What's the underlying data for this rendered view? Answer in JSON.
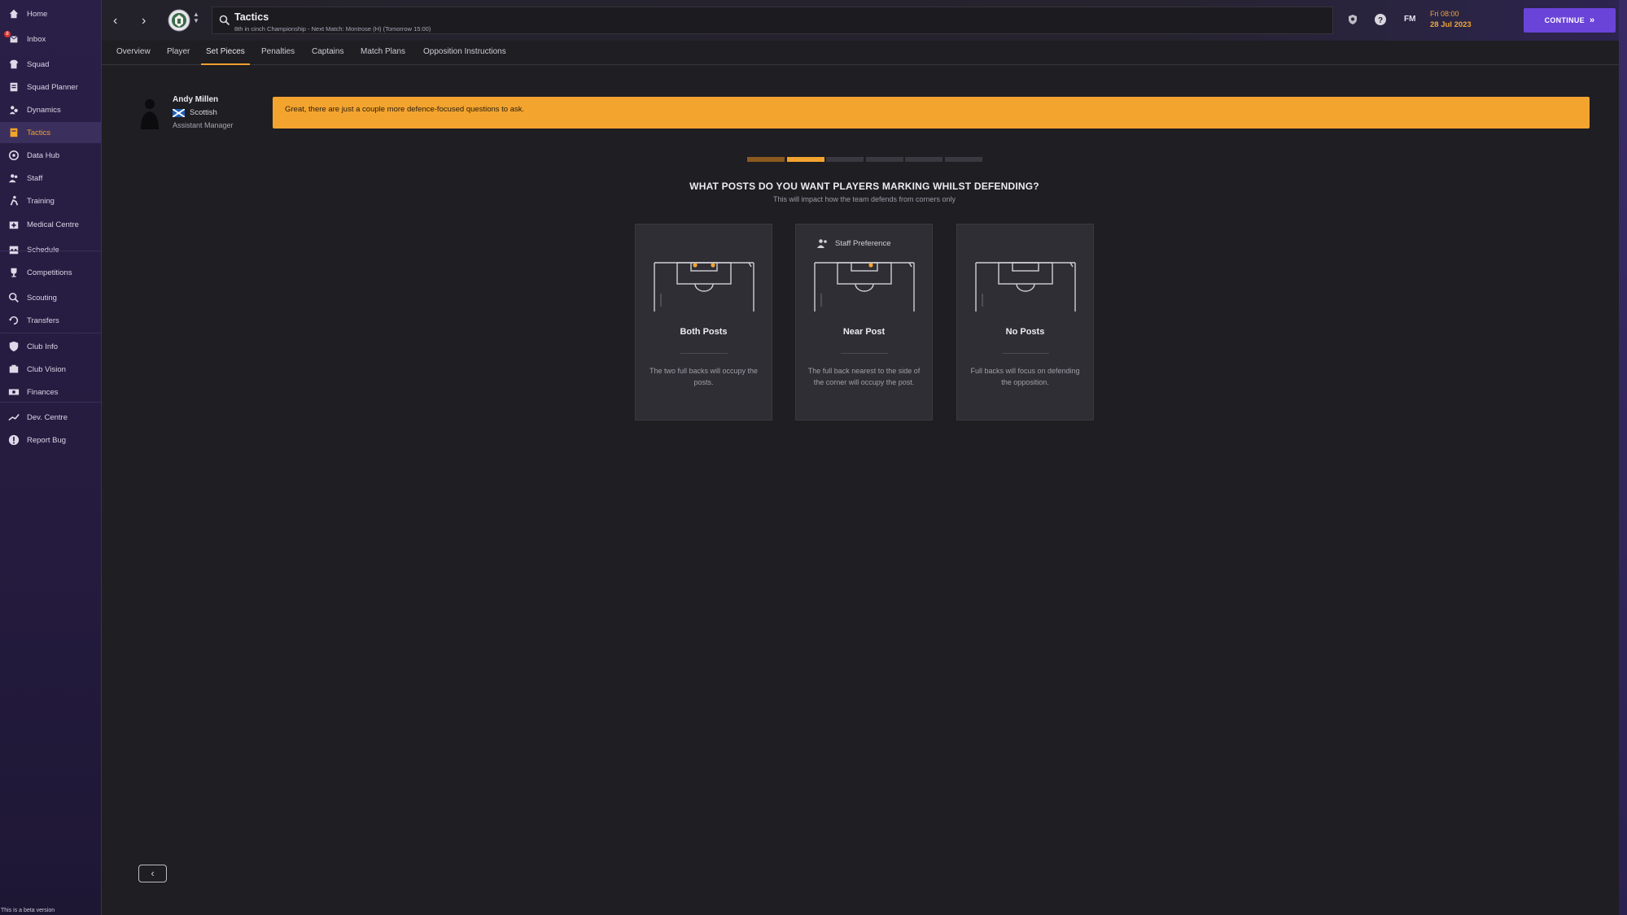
{
  "sidebar": {
    "items": [
      {
        "label": "Home",
        "icon": "home-icon"
      },
      {
        "label": "Inbox",
        "icon": "inbox-icon",
        "badge": "8"
      },
      {
        "label": "Squad",
        "icon": "shirt-icon"
      },
      {
        "label": "Squad Planner",
        "icon": "planner-icon"
      },
      {
        "label": "Dynamics",
        "icon": "dynamics-icon"
      },
      {
        "label": "Tactics",
        "icon": "tactics-icon",
        "active": true
      },
      {
        "label": "Data Hub",
        "icon": "data-hub-icon"
      },
      {
        "label": "Staff",
        "icon": "staff-icon"
      },
      {
        "label": "Training",
        "icon": "training-icon"
      },
      {
        "label": "Medical Centre",
        "icon": "medical-icon"
      },
      {
        "label": "Schedule",
        "icon": "calendar-icon"
      },
      {
        "label": "Competitions",
        "icon": "trophy-icon"
      },
      {
        "label": "Scouting",
        "icon": "scouting-icon"
      },
      {
        "label": "Transfers",
        "icon": "transfers-icon"
      },
      {
        "label": "Club Info",
        "icon": "shield-icon"
      },
      {
        "label": "Club Vision",
        "icon": "vision-icon"
      },
      {
        "label": "Finances",
        "icon": "finances-icon"
      },
      {
        "label": "Dev. Centre",
        "icon": "dev-centre-icon"
      },
      {
        "label": "Report Bug",
        "icon": "report-bug-icon"
      }
    ],
    "beta_note": "This is a beta version"
  },
  "header": {
    "title": "Tactics",
    "subtitle": "8th in cinch Championship - Next Match: Montrose (H) (Tomorrow 15:00)",
    "fm_label": "FM",
    "date_day": "Fri 08:00",
    "date_full": "28 Jul 2023",
    "continue_label": "CONTINUE"
  },
  "tabs": [
    {
      "label": "Overview"
    },
    {
      "label": "Player"
    },
    {
      "label": "Set Pieces",
      "active": true
    },
    {
      "label": "Penalties"
    },
    {
      "label": "Captains"
    },
    {
      "label": "Match Plans"
    },
    {
      "label": "Opposition Instructions"
    }
  ],
  "assistant": {
    "name": "Andy Millen",
    "nationality": "Scottish",
    "role": "Assistant Manager",
    "message": "Great, there are just a couple more defence-focused questions to ask."
  },
  "progress": {
    "total_steps": 6,
    "current_step": 2
  },
  "question": {
    "title": "WHAT POSTS DO YOU WANT PLAYERS MARKING WHILST DEFENDING?",
    "subtitle": "This will impact how the team defends from corners only"
  },
  "options": [
    {
      "title": "Both Posts",
      "desc": "The two full backs will occupy the posts.",
      "posts": "both",
      "staff_preference": ""
    },
    {
      "title": "Near Post",
      "desc": "The full back nearest to the side of the corner will occupy the post.",
      "posts": "near",
      "staff_preference": "Staff Preference"
    },
    {
      "title": "No Posts",
      "desc": "Full backs will focus on defending the opposition.",
      "posts": "none",
      "staff_preference": ""
    }
  ],
  "colors": {
    "accent": "#f3a42f",
    "continue": "#6a43d8",
    "sidebar": "#2a1f47"
  }
}
